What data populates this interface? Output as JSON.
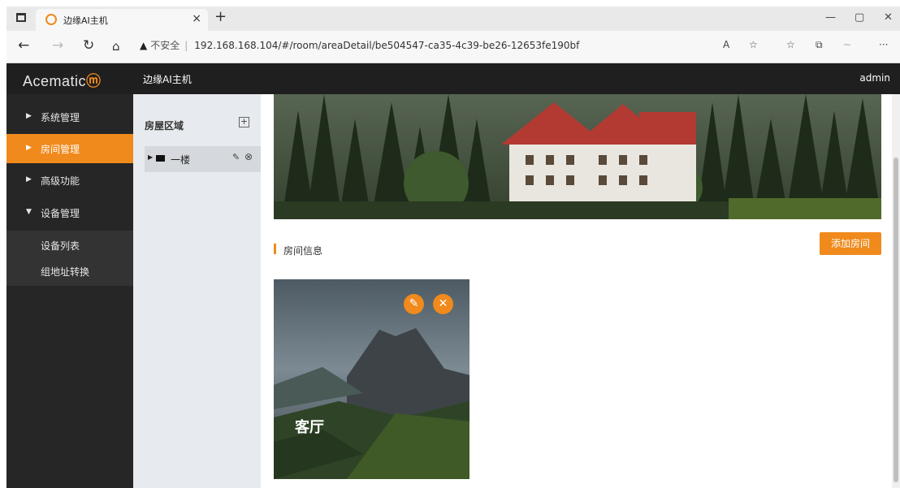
{
  "browser": {
    "tab_title": "边缘AI主机",
    "tab_close": "×",
    "new_tab": "+",
    "security_label": "不安全",
    "url": "192.168.168.104/#/room/areaDetail/be504547-ca35-4c39-be26-12653fe190bf",
    "minimize": "—",
    "restore": "▢",
    "close": "✕",
    "more": "···"
  },
  "app": {
    "logo_text": "Acematic",
    "title": "边缘AI主机",
    "user": "admin",
    "accent_color": "#f08a1c"
  },
  "sidebar": {
    "items": [
      {
        "label": "系统管理",
        "arrow": "▶"
      },
      {
        "label": "房间管理",
        "arrow": "▶"
      },
      {
        "label": "高级功能",
        "arrow": "▶"
      },
      {
        "label": "设备管理",
        "arrow": "▼"
      }
    ],
    "subitems": [
      {
        "label": "设备列表"
      },
      {
        "label": "组地址转换"
      }
    ]
  },
  "tree": {
    "header": "房屋区域",
    "nodes": [
      {
        "label": "一楼"
      }
    ]
  },
  "main": {
    "section_title": "房间信息",
    "add_button": "添加房间",
    "rooms": [
      {
        "name": "客厅"
      }
    ]
  }
}
